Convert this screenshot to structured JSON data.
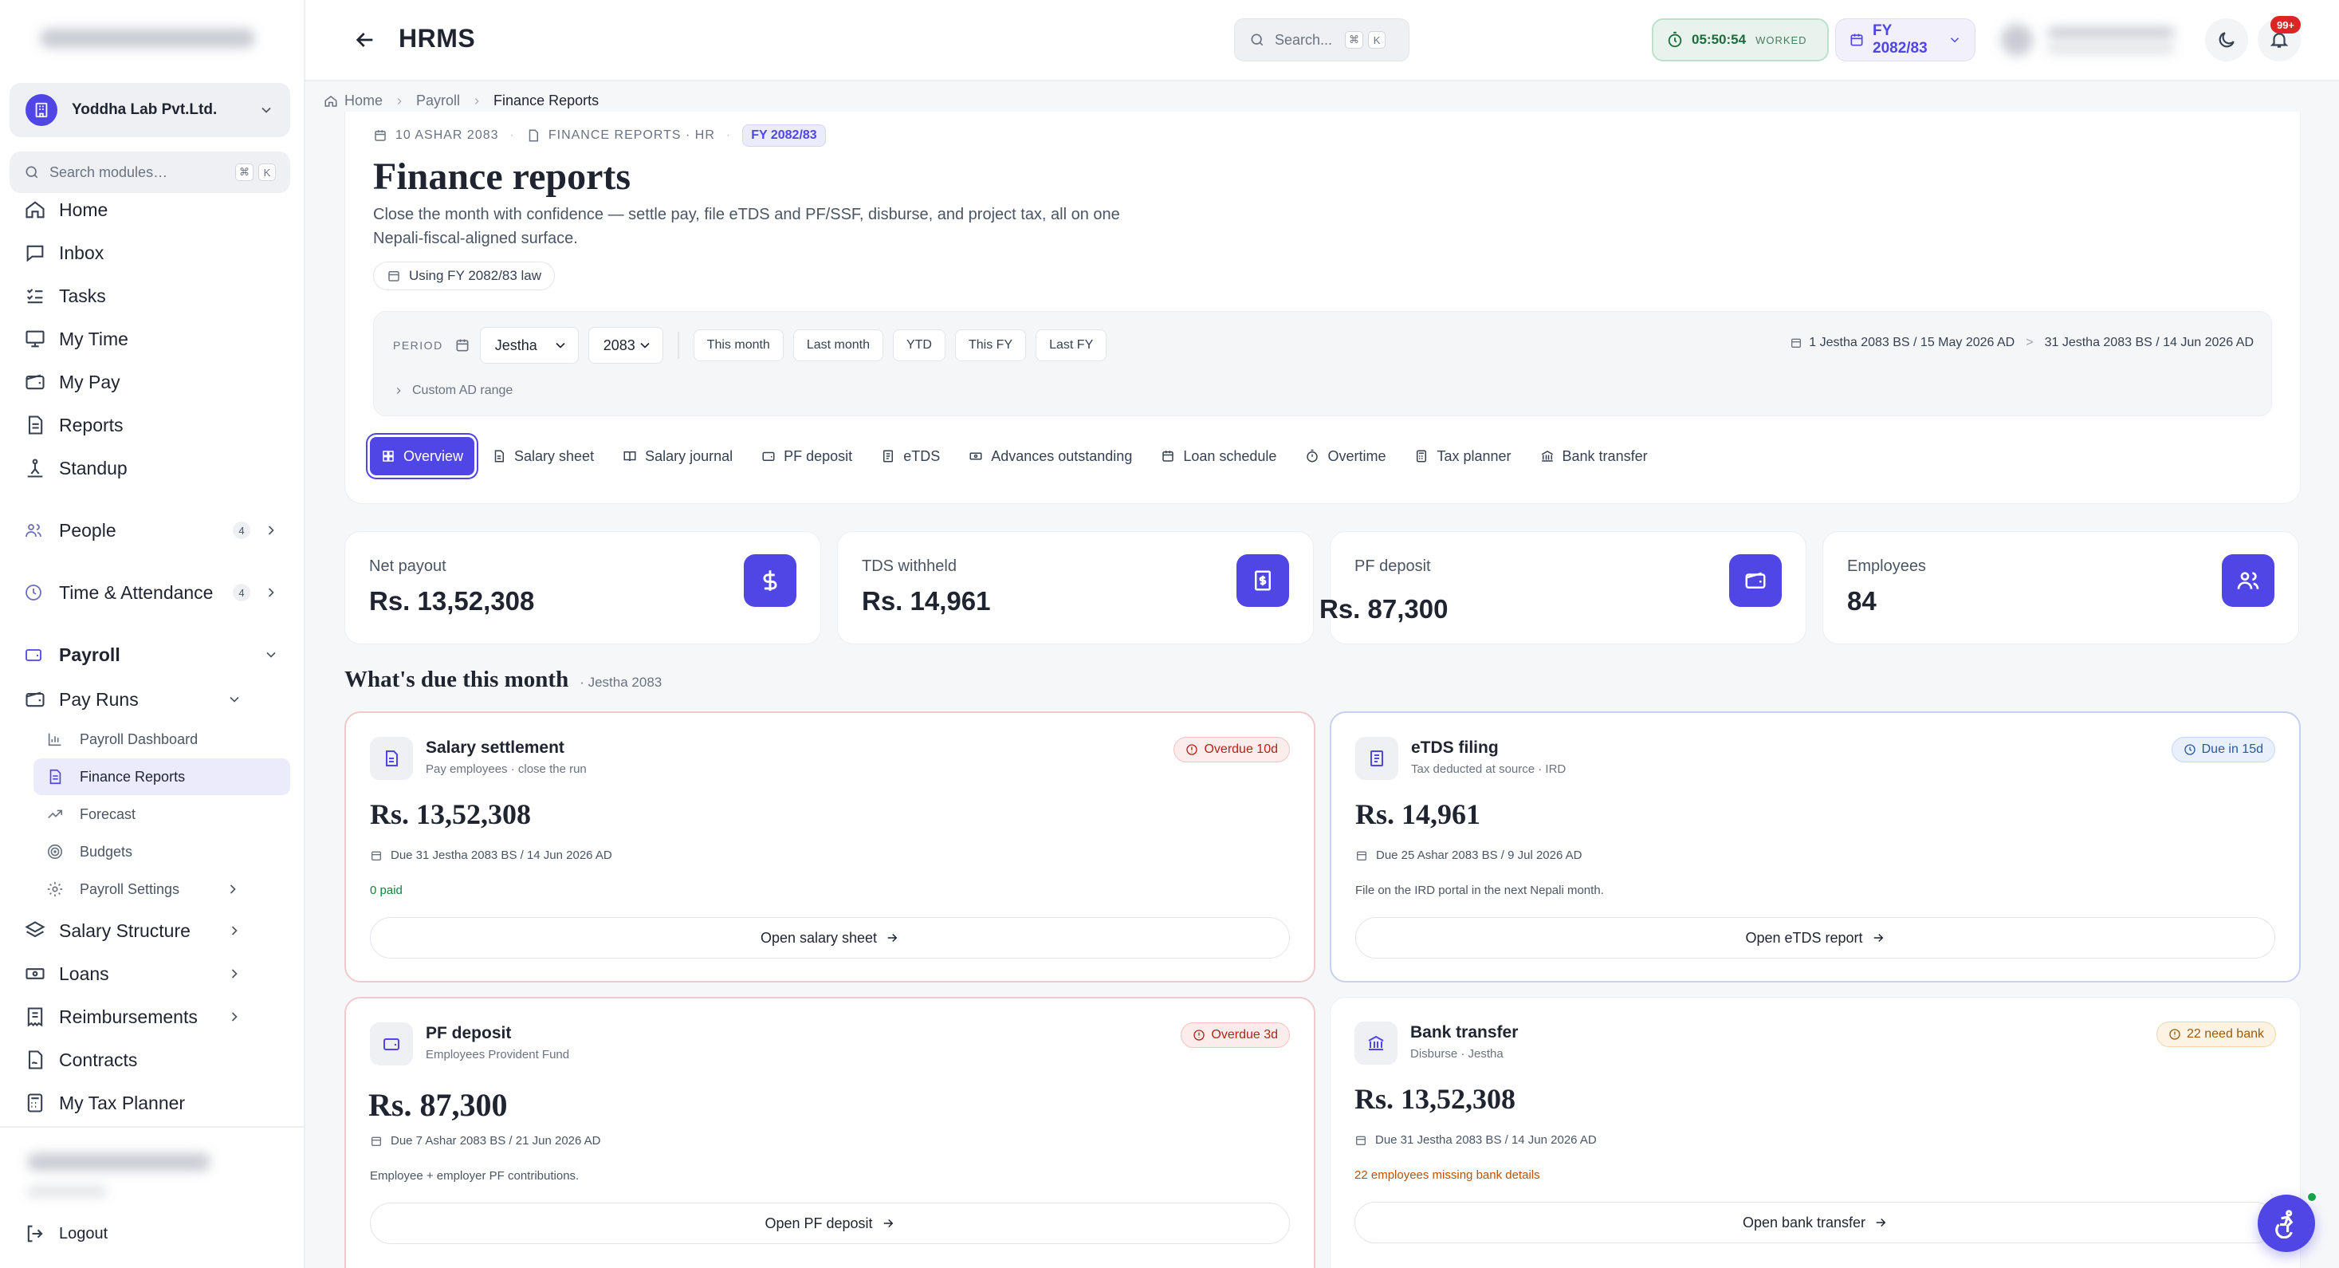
{
  "org": {
    "name": "Yoddha Lab Pvt.Ltd."
  },
  "module_search": {
    "placeholder": "Search modules…",
    "key1": "⌘",
    "key2": "K"
  },
  "nav": {
    "home": "Home",
    "inbox": "Inbox",
    "tasks": "Tasks",
    "my_time": "My Time",
    "my_pay": "My Pay",
    "reports": "Reports",
    "standup": "Standup",
    "people": "People",
    "people_count": "4",
    "time_attendance": "Time & Attendance",
    "time_attendance_count": "4",
    "payroll": "Payroll",
    "pay_runs": "Pay Runs",
    "payroll_dashboard": "Payroll Dashboard",
    "finance_reports": "Finance Reports",
    "forecast": "Forecast",
    "budgets": "Budgets",
    "payroll_settings": "Payroll Settings",
    "salary_structure": "Salary Structure",
    "loans": "Loans",
    "reimbursements": "Reimbursements",
    "contracts": "Contracts",
    "my_tax_planner": "My Tax Planner",
    "logout": "Logout"
  },
  "header": {
    "title": "HRMS",
    "search_placeholder": "Search...",
    "search_key1": "⌘",
    "search_key2": "K",
    "timer_value": "05:50:54",
    "timer_label": "WORKED",
    "fy_label": "FY 2082/83",
    "notif_count": "99+"
  },
  "breadcrumb": {
    "home": "Home",
    "payroll": "Payroll",
    "current": "Finance Reports"
  },
  "page": {
    "date": "10 ASHAR 2083",
    "section": "FINANCE REPORTS · HR",
    "fy_tag": "FY 2082/83",
    "title": "Finance reports",
    "description": "Close the month with confidence — settle pay, file eTDS and PF/SSF, disburse, and project tax, all on one Nepali-fiscal-aligned surface.",
    "law_chip": "Using FY 2082/83 law"
  },
  "period": {
    "label": "PERIOD",
    "month": "Jestha",
    "year": "2083",
    "quick": [
      "This month",
      "Last month",
      "YTD",
      "This FY",
      "Last FY"
    ],
    "range_start": "1 Jestha 2083 BS / 15 May 2026 AD",
    "range_end": "31 Jestha 2083 BS / 14 Jun 2026 AD",
    "range_sep": ">",
    "custom": "Custom AD range"
  },
  "tabs": [
    "Overview",
    "Salary sheet",
    "Salary journal",
    "PF deposit",
    "eTDS",
    "Advances outstanding",
    "Loan schedule",
    "Overtime",
    "Tax planner",
    "Bank transfer"
  ],
  "stats": [
    {
      "label": "Net payout",
      "value": "Rs. 13,52,308"
    },
    {
      "label": "TDS withheld",
      "value": "Rs. 14,961"
    },
    {
      "label": "PF deposit",
      "value": "Rs. 87,300"
    },
    {
      "label": "Employees",
      "value": "84"
    }
  ],
  "due": {
    "title": "What's due this month",
    "period": "· Jestha 2083",
    "cards": [
      {
        "title": "Salary settlement",
        "subtitle": "Pay employees · close the run",
        "badge": "Overdue 10d",
        "amount": "Rs. 13,52,308",
        "due": "Due 31 Jestha 2083 BS / 14 Jun 2026 AD",
        "note": "0 paid",
        "button": "Open salary sheet"
      },
      {
        "title": "eTDS filing",
        "subtitle": "Tax deducted at source · IRD",
        "badge": "Due in 15d",
        "amount": "Rs. 14,961",
        "due": "Due 25 Ashar 2083 BS / 9 Jul 2026 AD",
        "note": "File on the IRD portal in the next Nepali month.",
        "button": "Open eTDS report"
      },
      {
        "title": "PF deposit",
        "subtitle": "Employees Provident Fund",
        "badge": "Overdue 3d",
        "amount": "Rs. 87,300",
        "due": "Due 7 Ashar 2083 BS / 21 Jun 2026 AD",
        "note": "Employee + employer PF contributions.",
        "button": "Open PF deposit"
      },
      {
        "title": "Bank transfer",
        "subtitle": "Disburse · Jestha",
        "badge": "22 need bank",
        "amount": "Rs. 13,52,308",
        "due": "Due 31 Jestha 2083 BS / 14 Jun 2026 AD",
        "note": "22 employees missing bank details",
        "button": "Open bank transfer"
      }
    ]
  }
}
